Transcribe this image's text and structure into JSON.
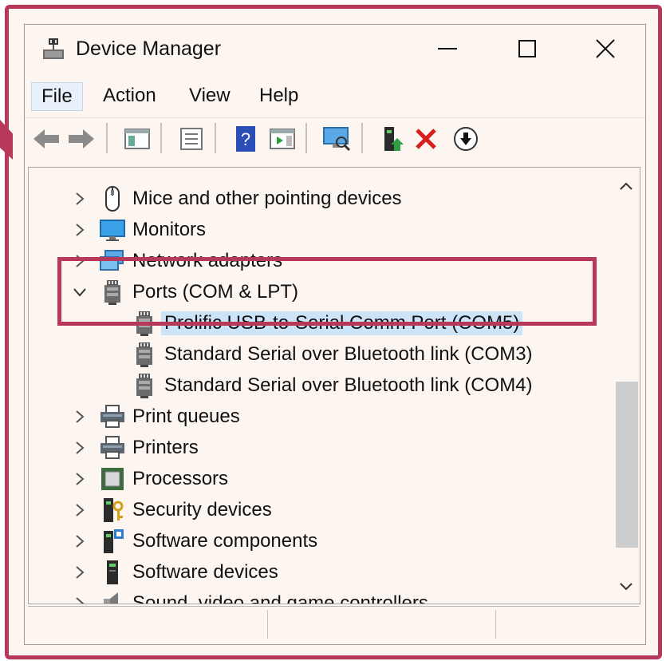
{
  "window": {
    "title": "Device Manager"
  },
  "menu": {
    "file": "File",
    "action": "Action",
    "view": "View",
    "help": "Help"
  },
  "toolbar": {
    "icons": [
      "back-arrow-icon",
      "forward-arrow-icon",
      "show-hide-console-tree-icon",
      "properties-icon",
      "help-icon",
      "action-pane-icon",
      "scan-hardware-icon",
      "update-driver-icon",
      "uninstall-icon",
      "disable-device-icon"
    ]
  },
  "tree": {
    "items": [
      {
        "label": "Mice and other pointing devices",
        "icon": "mouse-icon",
        "expanded": false
      },
      {
        "label": "Monitors",
        "icon": "monitor-icon",
        "expanded": false
      },
      {
        "label": "Network adapters",
        "icon": "network-adapter-icon",
        "expanded": false
      },
      {
        "label": "Ports (COM & LPT)",
        "icon": "port-icon",
        "expanded": true
      },
      {
        "label": "Prolific USB-to-Serial Comm Port (COM5)",
        "icon": "port-icon",
        "child": true,
        "selected": true
      },
      {
        "label": "Standard Serial over Bluetooth link (COM3)",
        "icon": "port-icon",
        "child": true
      },
      {
        "label": "Standard Serial over Bluetooth link (COM4)",
        "icon": "port-icon",
        "child": true
      },
      {
        "label": "Print queues",
        "icon": "printer-icon",
        "expanded": false
      },
      {
        "label": "Printers",
        "icon": "printer-icon",
        "expanded": false
      },
      {
        "label": "Processors",
        "icon": "processor-icon",
        "expanded": false
      },
      {
        "label": "Security devices",
        "icon": "security-device-icon",
        "expanded": false
      },
      {
        "label": "Software components",
        "icon": "software-component-icon",
        "expanded": false
      },
      {
        "label": "Software devices",
        "icon": "software-device-icon",
        "expanded": false
      },
      {
        "label": "Sound, video and game controllers",
        "icon": "speaker-icon",
        "expanded": false
      }
    ]
  },
  "colors": {
    "highlight": "#b8385a",
    "selection": "#cce4f7",
    "window_bg": "#fdf6f0"
  }
}
